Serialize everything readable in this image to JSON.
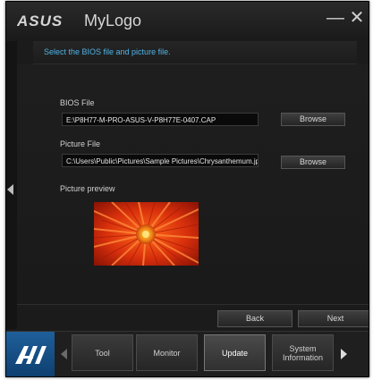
{
  "app": {
    "brand": "ASUS",
    "title": "MyLogo"
  },
  "titlebar": {
    "minimize_symbol": "—",
    "close_symbol": "✕"
  },
  "instruction": "Select the BIOS file and picture file.",
  "bios": {
    "label": "BIOS File",
    "value": "E:\\P8H77-M-PRO-ASUS-V-P8H77E-0407.CAP",
    "browse_label": "Browse"
  },
  "picture": {
    "label": "Picture File",
    "value": "C:\\Users\\Public\\Pictures\\Sample Pictures\\Chrysanthemum.jpg",
    "browse_label": "Browse"
  },
  "preview": {
    "label": "Picture preview"
  },
  "navigation": {
    "back_label": "Back",
    "next_label": "Next"
  },
  "taskbar": {
    "tabs": [
      {
        "label": "Tool",
        "active": false
      },
      {
        "label": "Monitor",
        "active": false
      },
      {
        "label": "Update",
        "active": true
      },
      {
        "label": "System\nInformation",
        "active": false
      }
    ]
  },
  "colors": {
    "accent": "#4fb3e6",
    "ai_button": "#1f5f9a",
    "window_bg": "#1b1b1b"
  },
  "icons": {
    "ai_logo": "ai-suite-logo-icon",
    "left_arrow": "chevron-left-icon",
    "right_arrow": "chevron-right-icon"
  }
}
